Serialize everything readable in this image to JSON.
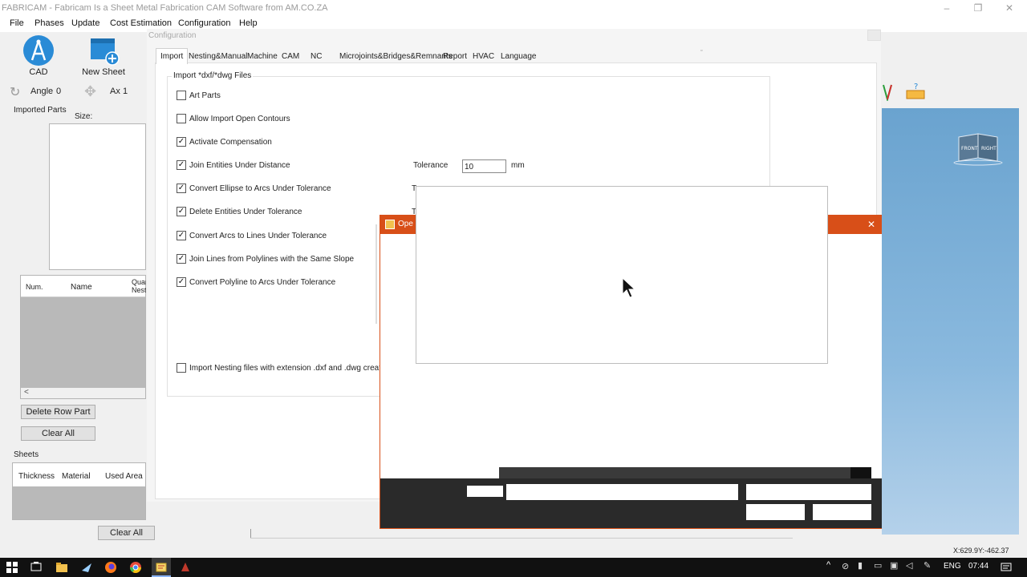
{
  "window": {
    "title": "FABRICAM - Fabricam Is a Sheet Metal Fabrication CAM Software from AM.CO.ZA"
  },
  "menu": [
    "File",
    "Phases",
    "Update",
    "Cost Estimation",
    "Configuration",
    "Help"
  ],
  "toolbar": {
    "cad_label": "CAD",
    "new_sheet_label": "New Sheet",
    "angle_label": "Angle",
    "angle_value": "0",
    "ax_label": "Ax",
    "ax_value": "1"
  },
  "imported_parts": {
    "title": "Imported Parts",
    "size_label": "Size:",
    "columns": [
      "Num.",
      "Name",
      "Quan Nest"
    ],
    "delete_row_label": "Delete Row Part",
    "clear_all_label": "Clear All"
  },
  "sheets": {
    "title": "Sheets",
    "columns": [
      "Thickness",
      "Material",
      "Used Area"
    ],
    "clear_all_label": "Clear All"
  },
  "config": {
    "title": "Configuration",
    "tabs": [
      "Import",
      "Nesting&Manual",
      "Machine",
      "CAM",
      "NC",
      "Microjoints&Bridges&Remnants",
      "Report",
      "HVAC",
      "Language"
    ],
    "group_label": "Import *dxf/*dwg Files",
    "options": [
      {
        "label": "Art Parts",
        "checked": false
      },
      {
        "label": "Allow Import Open Contours",
        "checked": false
      },
      {
        "label": "Activate Compensation",
        "checked": true
      },
      {
        "label": "Join Entities Under Distance",
        "checked": true
      },
      {
        "label": "Convert Ellipse to Arcs Under Tolerance",
        "checked": true
      },
      {
        "label": "Delete Entities Under Tolerance",
        "checked": true
      },
      {
        "label": "Convert Arcs to Lines Under Tolerance",
        "checked": true
      },
      {
        "label": "Join Lines from Polylines with the Same Slope",
        "checked": true
      },
      {
        "label": "Convert Polyline to Arcs Under Tolerance",
        "checked": true
      }
    ],
    "nesting_option": {
      "label": "Import Nesting files with extension .dxf and .dwg created by p",
      "checked": false
    },
    "tolerance_label": "Tolerance",
    "tolerance_value": "10",
    "tolerance_unit": "mm",
    "tol_short": "T"
  },
  "dialog": {
    "title": "Ope",
    "close": "✕"
  },
  "view": {
    "front": "FRONT",
    "right": "RIGHT"
  },
  "status": {
    "coords": "X:629.9Y:-462.37"
  },
  "taskbar": {
    "lang": "ENG",
    "time": "07:44"
  }
}
